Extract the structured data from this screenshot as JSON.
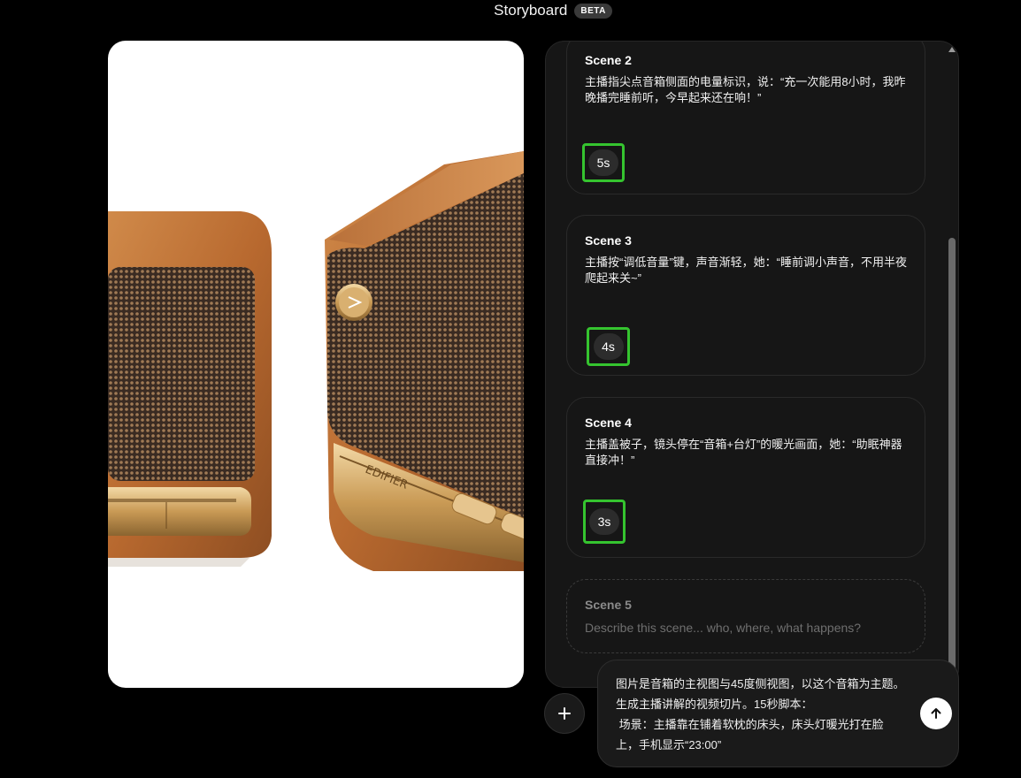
{
  "header": {
    "title": "Storyboard",
    "badge": "BETA"
  },
  "scenes": [
    {
      "title": "Scene 2",
      "text": "主播指尖点音箱侧面的电量标识，说：“充一次能用8小时，我昨晚播完睡前听，今早起来还在响！”",
      "duration": "5s"
    },
    {
      "title": "Scene 3",
      "text": "主播按“调低音量”键，声音渐轻，她：“睡前调小声音，不用半夜爬起来关~”",
      "duration": "4s"
    },
    {
      "title": "Scene 4",
      "text": "主播盖被子，镜头停在“音箱+台灯”的暖光画面，她：“助眠神器直接冲！”",
      "duration": "3s"
    }
  ],
  "new_scene": {
    "title": "Scene 5",
    "placeholder": "Describe this scene... who, where, what happens?"
  },
  "prompt": {
    "text": "图片是音箱的主视图与45度侧视图，以这个音箱为主题。生成主播讲解的视频切片。15秒脚本：\n 场景：主播靠在铺着软枕的床头，床头灯暖光打在脸上，手机显示“23:00”"
  },
  "add_button_icon": "plus-icon",
  "send_button_icon": "arrow-up-icon",
  "preview_image": {
    "brand_mark": "EDIFIER"
  },
  "colors": {
    "highlight": "#35c42f",
    "panel": "#161616",
    "background": "#000000"
  }
}
